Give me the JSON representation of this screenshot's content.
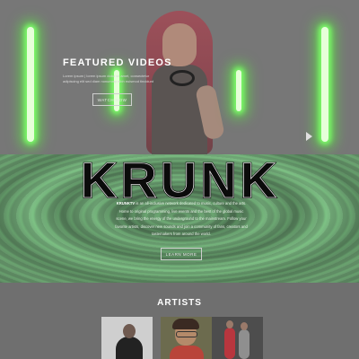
{
  "hero": {
    "title": "FEATURED VIDEOS",
    "text": "Lorem ipsum | lorem ipsum dolor sit amet, consectetur adipiscing elit sed diam nonummy nibh euismod tincidunt",
    "button_label": "WATCH NOW"
  },
  "logo": {
    "text": "KRUNK"
  },
  "about": {
    "brand": "KRUNKTV",
    "text": "is an all-inclusive network dedicated to music, culture and the arts. Home to original programming, live events and the best of the global music scene, we bring the energy of the underground to the mainstream. Follow your favorite artists, discover new sounds and join a community of fans, creators and tastemakers from around the world.",
    "button_label": "LEARN MORE"
  },
  "artists": {
    "title": "ARTISTS"
  },
  "colors": {
    "neon": "#7dff6a",
    "overlay_gray": "#6e6e6e",
    "swirl_green": "#6da273"
  }
}
